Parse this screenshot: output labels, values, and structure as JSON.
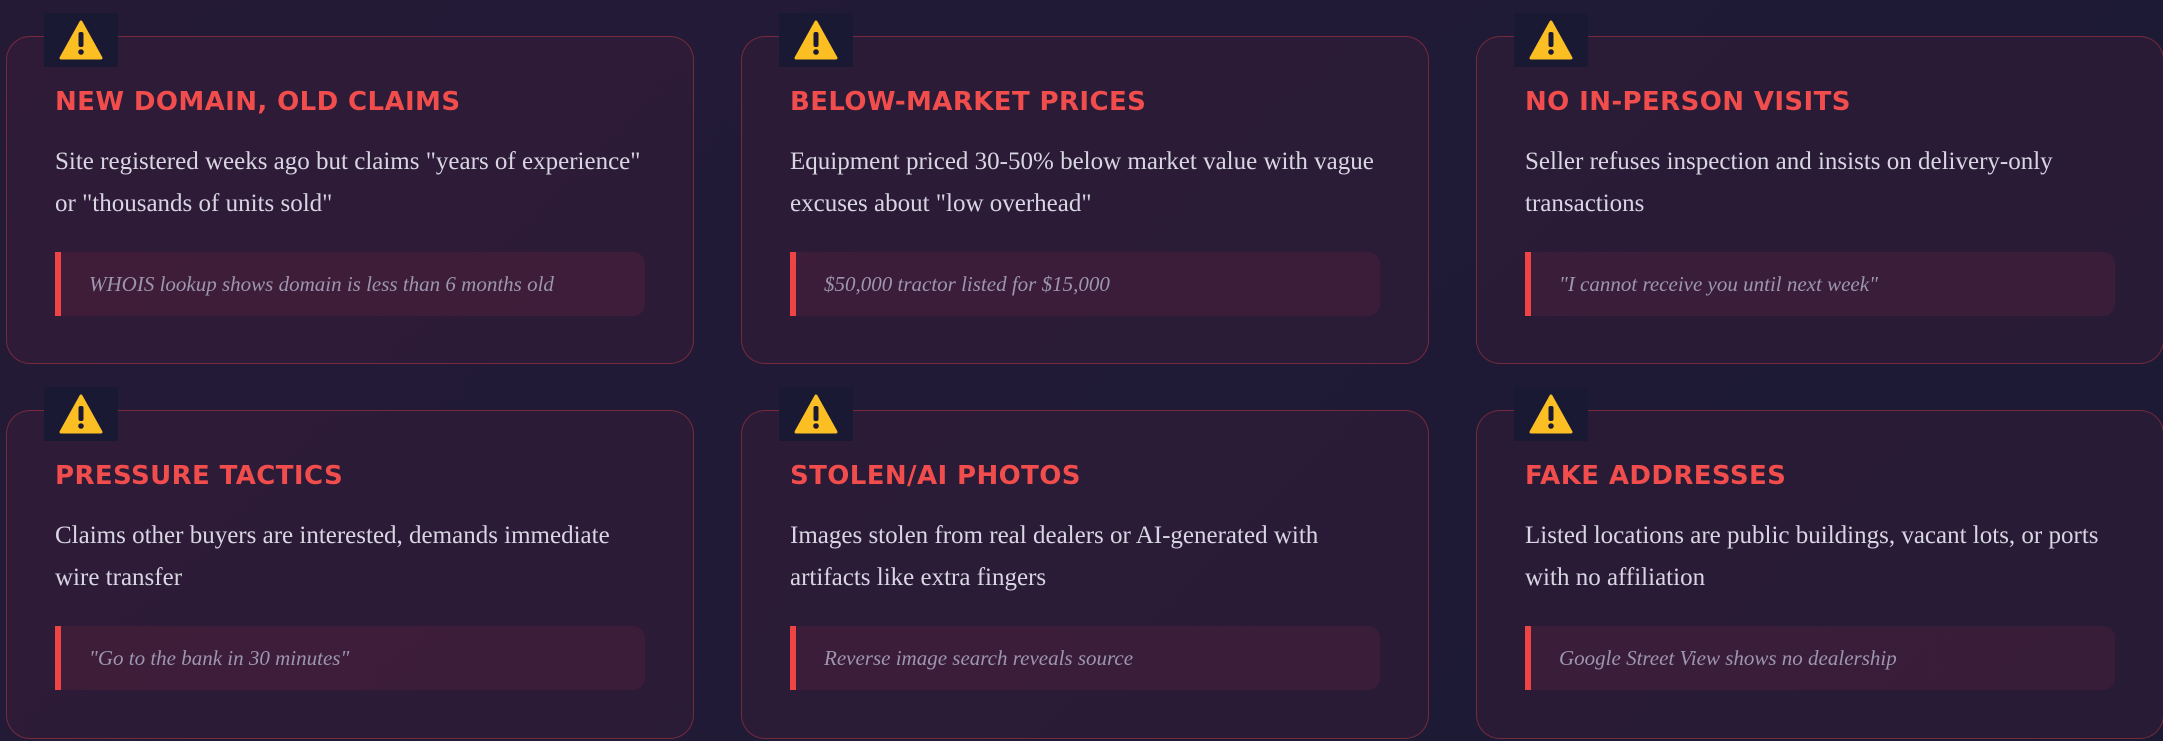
{
  "cards": [
    {
      "icon": "warning-icon",
      "title": "NEW DOMAIN, OLD CLAIMS",
      "description": "Site registered weeks ago but claims \"years of experience\" or \"thousands of units sold\"",
      "example": "WHOIS lookup shows domain is less than 6 months old"
    },
    {
      "icon": "warning-icon",
      "title": "BELOW-MARKET PRICES",
      "description": "Equipment priced 30-50% below market value with vague excuses about \"low overhead\"",
      "example": "$50,000 tractor listed for $15,000"
    },
    {
      "icon": "warning-icon",
      "title": "NO IN-PERSON VISITS",
      "description": "Seller refuses inspection and insists on delivery-only transactions",
      "example": "\"I cannot receive you until next week\""
    },
    {
      "icon": "warning-icon",
      "title": "PRESSURE TACTICS",
      "description": "Claims other buyers are interested, demands immediate wire transfer",
      "example": "\"Go to the bank in 30 minutes\""
    },
    {
      "icon": "warning-icon",
      "title": "STOLEN/AI PHOTOS",
      "description": "Images stolen from real dealers or AI-generated with artifacts like extra fingers",
      "example": "Reverse image search reveals source"
    },
    {
      "icon": "warning-icon",
      "title": "FAKE ADDRESSES",
      "description": "Listed locations are public buildings, vacant lots, or ports with no affiliation",
      "example": "Google Street View shows no dealership"
    }
  ],
  "colors": {
    "accent": "#ef4444",
    "title": "#f24d4d",
    "text": "#d8d6e2",
    "muted": "#9c96ae",
    "background": "#211a36",
    "warning": "#fbbf24"
  }
}
